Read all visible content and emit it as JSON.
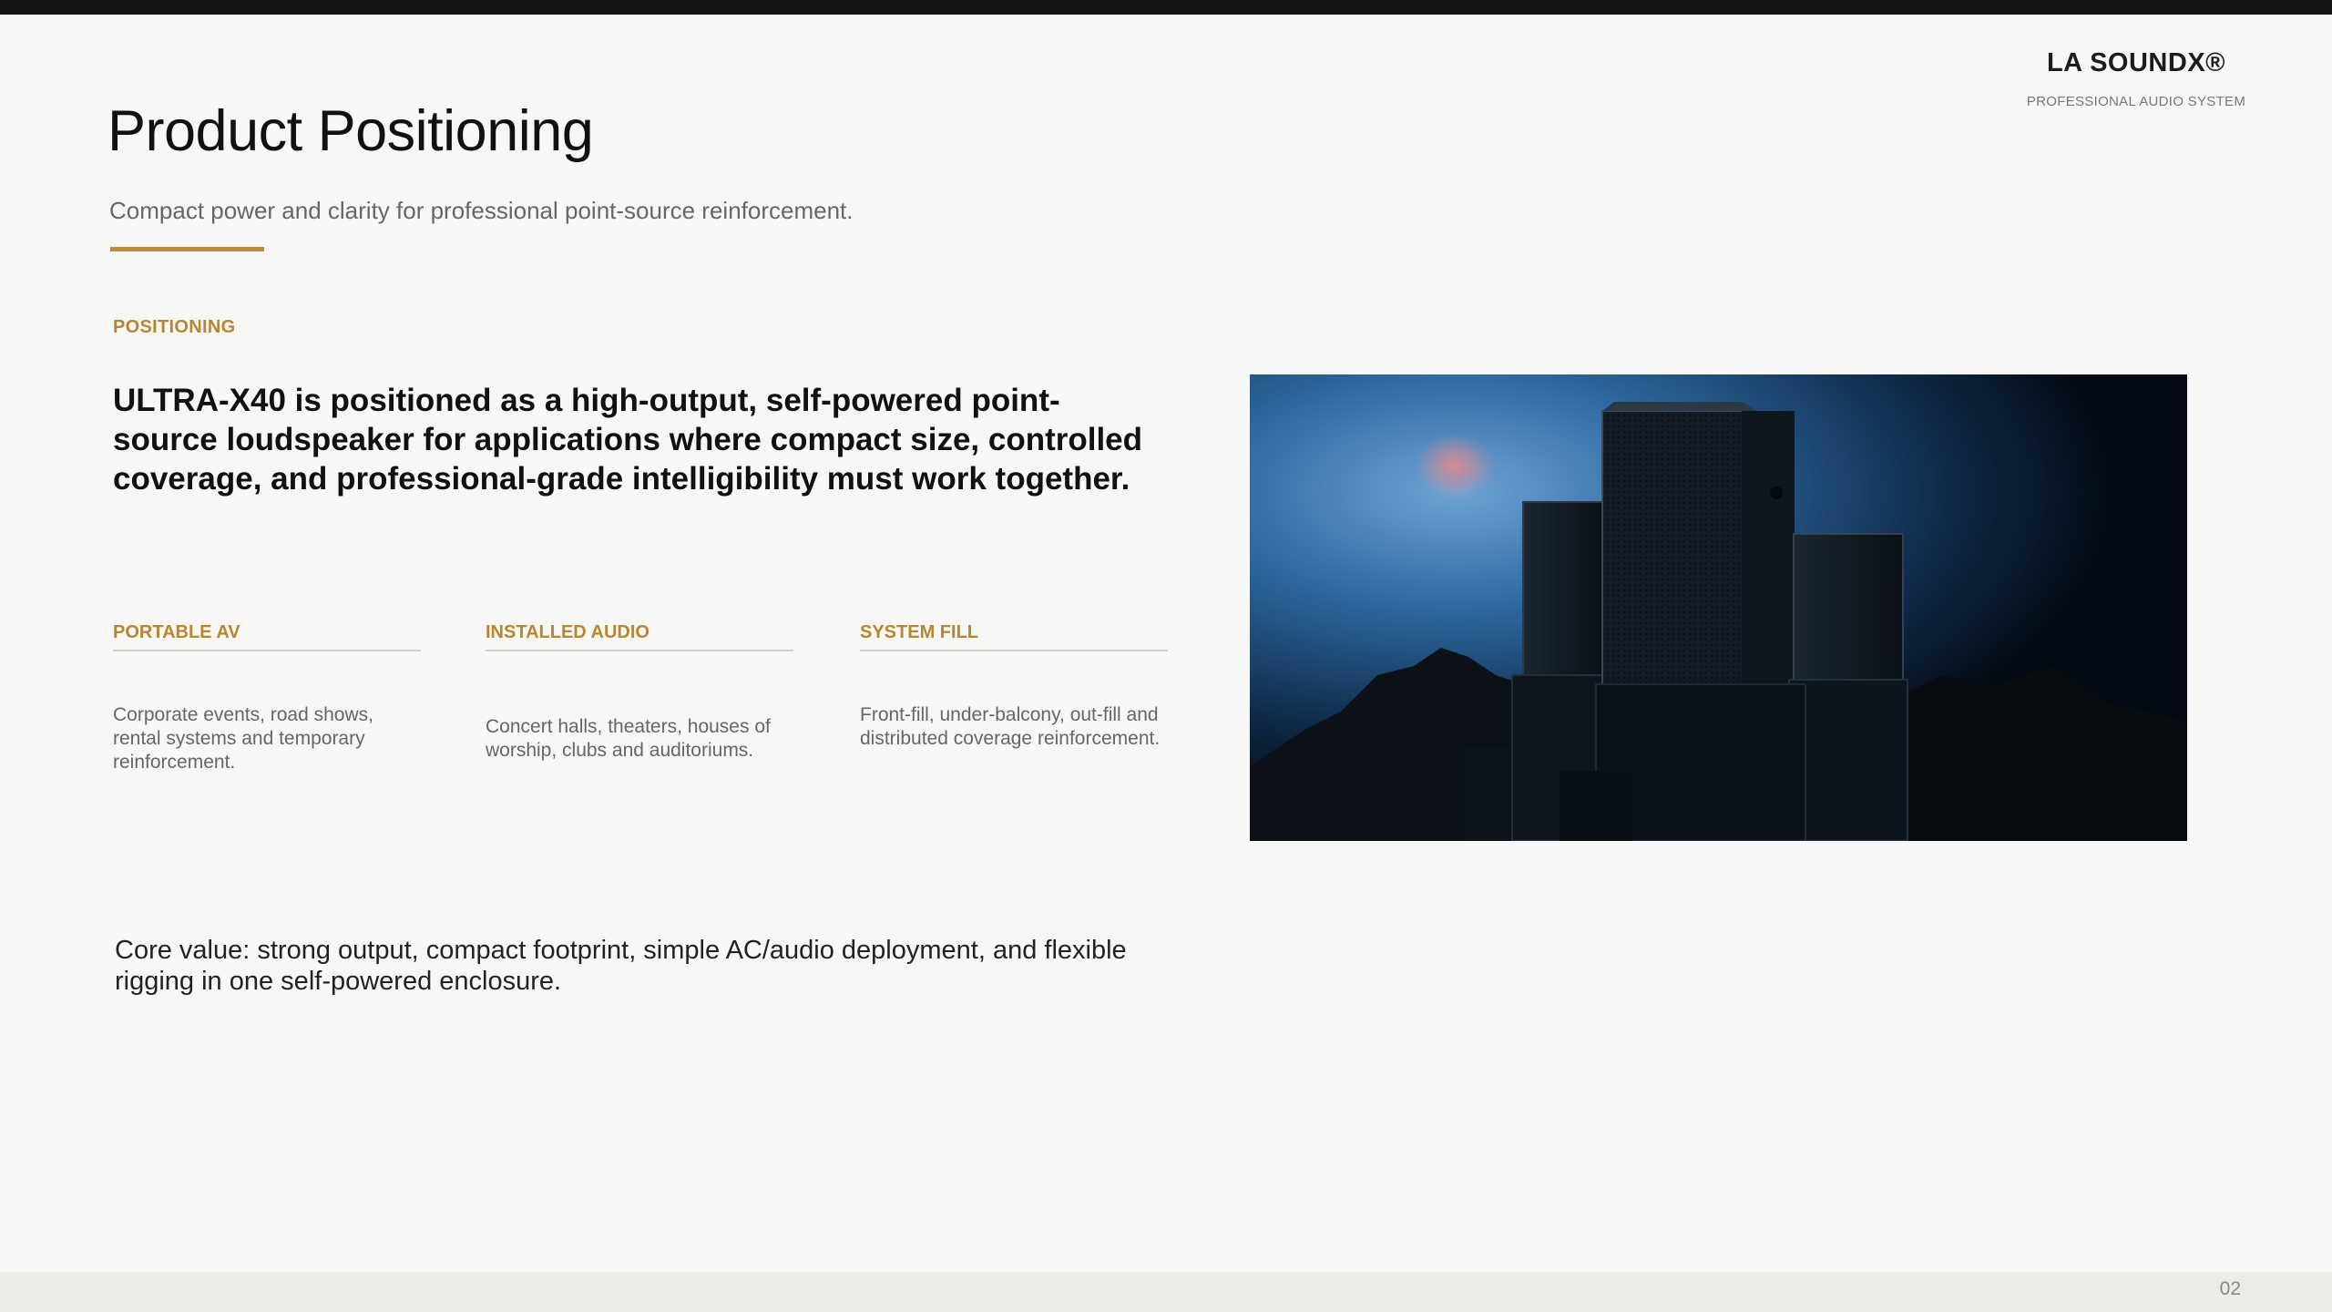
{
  "brand": {
    "name": "LA SOUNDX®",
    "tagline": "PROFESSIONAL AUDIO SYSTEM"
  },
  "title": "Product Positioning",
  "subtitle": "Compact power and clarity for professional point-source reinforcement.",
  "section_label": "POSITIONING",
  "statement": "ULTRA-X40 is positioned as a high-output, self-powered point-source loudspeaker for applications where compact size, controlled coverage, and professional-grade intelligibility must work together.",
  "applications": [
    {
      "label": "PORTABLE AV",
      "body": "Corporate events, road shows, rental systems and temporary reinforcement."
    },
    {
      "label": "INSTALLED AUDIO",
      "body": "Concert halls, theaters, houses of worship, clubs and auditoriums."
    },
    {
      "label": "SYSTEM FILL",
      "body": "Front-fill, under-balcony, out-fill and distributed coverage reinforcement."
    }
  ],
  "core_value": "Core value: strong output, compact footprint, simple AC/audio deployment, and flexible rigging in one self-powered enclosure.",
  "page_number": "02",
  "colors": {
    "accent": "#c08a35",
    "background": "#f7f7f5",
    "text_dark": "#111111"
  }
}
